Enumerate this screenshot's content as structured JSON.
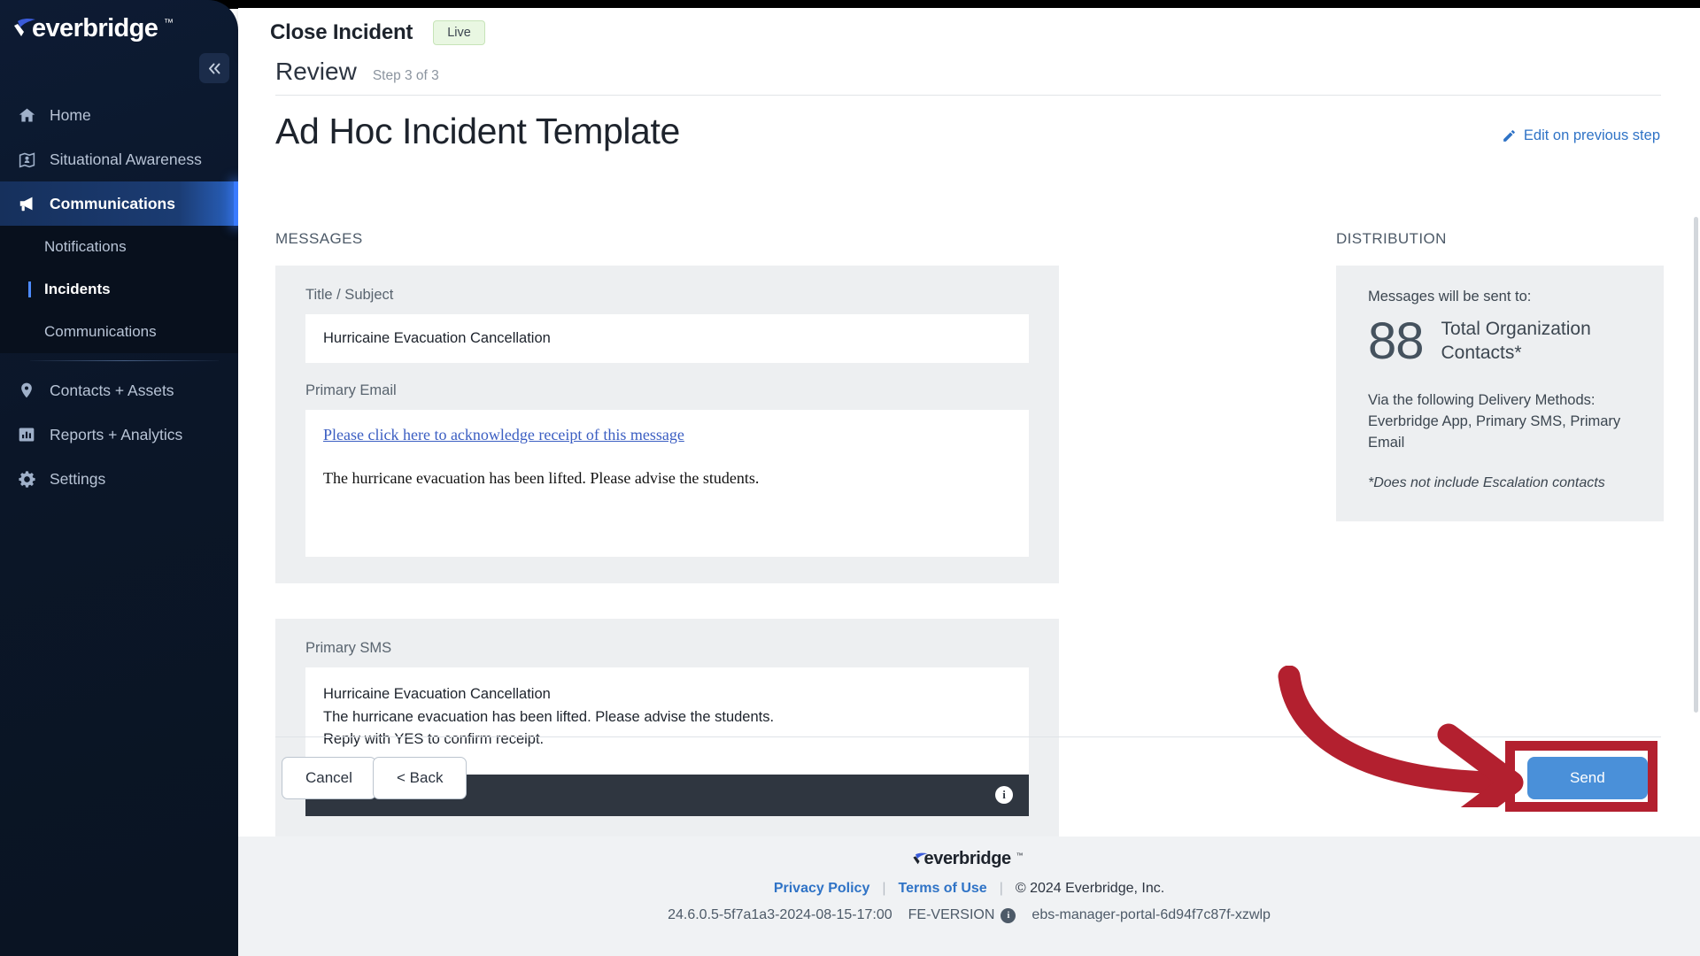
{
  "brand": {
    "name": "everbridge",
    "tm": "™",
    "accent_blue": "#2f73c6",
    "accent_green": "#4ca829",
    "annotation_red": "#b3202f",
    "send_blue": "#4a90d9"
  },
  "sidebar": {
    "collapse_icon": "chevron-double-left-icon",
    "items": [
      {
        "label": "Home",
        "icon": "home-icon",
        "active": false
      },
      {
        "label": "Situational Awareness",
        "icon": "map-pin-person-icon",
        "active": false
      },
      {
        "label": "Communications",
        "icon": "megaphone-icon",
        "active": true
      },
      {
        "label": "Contacts + Assets",
        "icon": "location-pin-icon",
        "active": false
      },
      {
        "label": "Reports + Analytics",
        "icon": "bar-chart-icon",
        "active": false
      },
      {
        "label": "Settings",
        "icon": "gear-icon",
        "active": false
      }
    ],
    "subitems": [
      {
        "label": "Notifications",
        "current": false
      },
      {
        "label": "Incidents",
        "current": true
      },
      {
        "label": "Communications",
        "current": false
      }
    ]
  },
  "header": {
    "title": "Close Incident",
    "status_badge": "Live"
  },
  "step": {
    "title": "Review",
    "subtitle": "Step 3 of 3"
  },
  "page": {
    "title": "Ad Hoc Incident Template",
    "edit_link": "Edit on previous step",
    "edit_icon": "pencil-icon"
  },
  "messages": {
    "section_label": "MESSAGES",
    "title_field": {
      "label": "Title / Subject",
      "value": "Hurricaine Evacuation Cancellation"
    },
    "email": {
      "label": "Primary Email",
      "ack_link": "Please click here to acknowledge receipt of this message",
      "body": "The hurricane evacuation has been lifted. Please advise the students."
    },
    "sms": {
      "label": "Primary SMS",
      "line1": "Hurricaine Evacuation Cancellation",
      "line2": "The hurricane evacuation has been lifted.  Please advise the students.",
      "line3": "Reply with YES to confirm receipt.",
      "info_icon": "info-icon"
    }
  },
  "distribution": {
    "section_label": "DISTRIBUTION",
    "lead": "Messages will be sent to:",
    "count": "88",
    "count_label_line1": "Total Organization",
    "count_label_line2": "Contacts*",
    "via_label": "Via the following Delivery Methods:",
    "via_methods": "Everbridge App, Primary SMS, Primary Email",
    "note": "*Does not include Escalation contacts"
  },
  "actions": {
    "cancel": "Cancel",
    "back": "< Back",
    "send": "Send"
  },
  "annotations": {
    "arrow": "curved-red-arrow-pointing-to-send",
    "highlight_box": "red-rectangle-around-send-button"
  },
  "footer": {
    "privacy": "Privacy Policy",
    "terms": "Terms of Use",
    "copyright": "© 2024 Everbridge, Inc.",
    "version": "24.6.0.5-5f7a1a3-2024-08-15-17:00",
    "fe_version_label": "FE-VERSION",
    "fe_version_icon": "info-icon",
    "pod": "ebs-manager-portal-6d94f7c87f-xzwlp"
  }
}
